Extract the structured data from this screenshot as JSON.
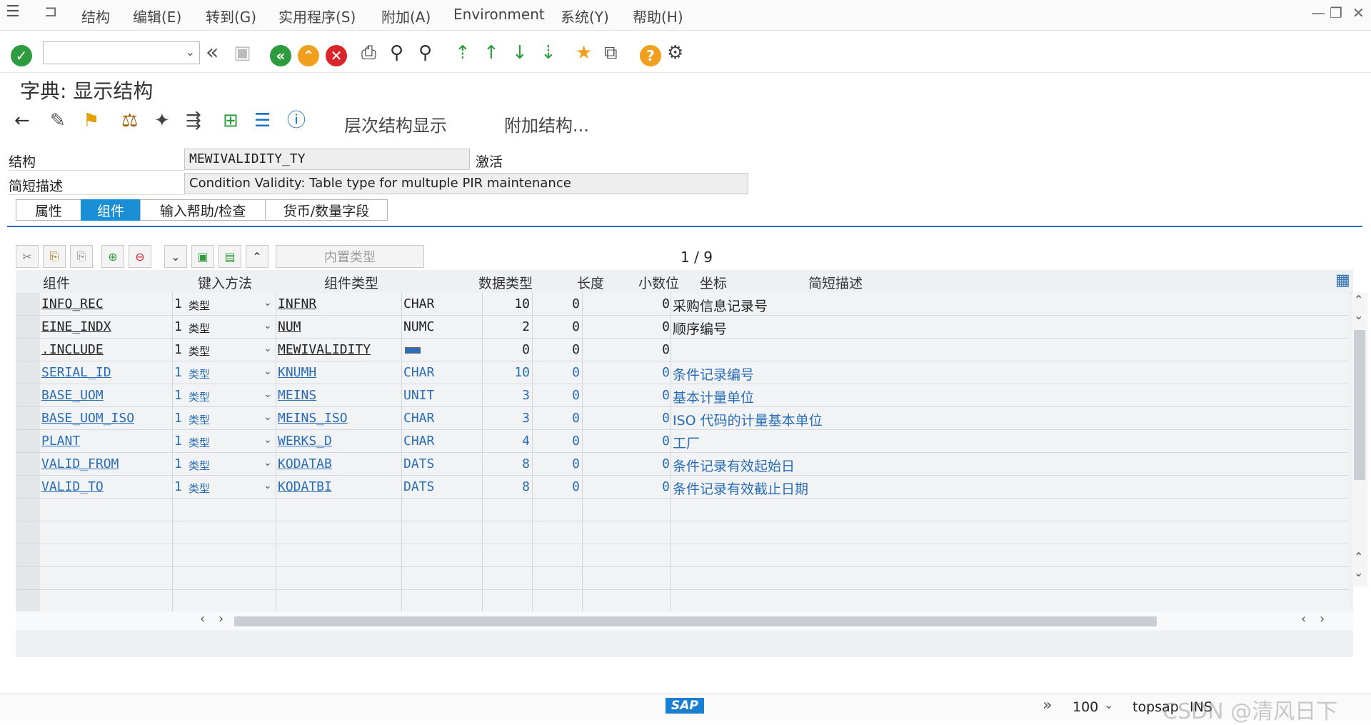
{
  "menu": {
    "items": [
      "结构",
      "编辑(E)",
      "转到(G)",
      "实用程序(S)",
      "附加(A)",
      "Environment",
      "系统(Y)",
      "帮助(H)"
    ]
  },
  "page": {
    "title": "字典: 显示结构"
  },
  "app_toolbar": {
    "hierarchy_label": "层次结构显示",
    "append_label": "附加结构..."
  },
  "fields": {
    "structure_label": "结构",
    "structure_value": "MEWIVALIDITY_TY",
    "status": "激活",
    "desc_label": "简短描述",
    "desc_value": "Condition Validity: Table type for multuple PIR maintenance"
  },
  "tabs": [
    "属性",
    "组件",
    "输入帮助/检查",
    "货币/数量字段"
  ],
  "grid_toolbar": {
    "builtin_type_label": "内置类型",
    "page_current": "1",
    "page_sep": "/",
    "page_total": "9"
  },
  "grid": {
    "headers": [
      "组件",
      "键入方法",
      "组件类型",
      "数据类型",
      "长度",
      "小数位",
      "坐标",
      "简短描述"
    ],
    "rows": [
      {
        "name": "INFO_REC",
        "method": "1",
        "method_label": "类型",
        "type": "INFNR",
        "dtype": "CHAR",
        "len": "10",
        "dec": "0",
        "coord": "0",
        "desc": "采购信息记录号",
        "style": "blk"
      },
      {
        "name": "EINE_INDX",
        "method": "1",
        "method_label": "类型",
        "type": "NUM",
        "dtype": "NUMC",
        "len": "2",
        "dec": "0",
        "coord": "0",
        "desc": "顺序编号",
        "style": "blk"
      },
      {
        "name": ".INCLUDE",
        "method": "1",
        "method_label": "类型",
        "type": "MEWIVALIDITY",
        "dtype": "",
        "len": "0",
        "dec": "0",
        "coord": "0",
        "desc": "",
        "style": "blk"
      },
      {
        "name": "SERIAL_ID",
        "method": "1",
        "method_label": "类型",
        "type": "KNUMH",
        "dtype": "CHAR",
        "len": "10",
        "dec": "0",
        "coord": "0",
        "desc": "条件记录编号",
        "style": "blue"
      },
      {
        "name": "BASE_UOM",
        "method": "1",
        "method_label": "类型",
        "type": "MEINS",
        "dtype": "UNIT",
        "len": "3",
        "dec": "0",
        "coord": "0",
        "desc": "基本计量单位",
        "style": "blue"
      },
      {
        "name": "BASE_UOM_ISO",
        "method": "1",
        "method_label": "类型",
        "type": "MEINS_ISO",
        "dtype": "CHAR",
        "len": "3",
        "dec": "0",
        "coord": "0",
        "desc": "ISO 代码的计量基本单位",
        "style": "blue"
      },
      {
        "name": "PLANT",
        "method": "1",
        "method_label": "类型",
        "type": "WERKS_D",
        "dtype": "CHAR",
        "len": "4",
        "dec": "0",
        "coord": "0",
        "desc": "工厂",
        "style": "blue"
      },
      {
        "name": "VALID_FROM",
        "method": "1",
        "method_label": "类型",
        "type": "KODATAB",
        "dtype": "DATS",
        "len": "8",
        "dec": "0",
        "coord": "0",
        "desc": "条件记录有效起始日",
        "style": "blue"
      },
      {
        "name": "VALID_TO",
        "method": "1",
        "method_label": "类型",
        "type": "KODATBI",
        "dtype": "DATS",
        "len": "8",
        "dec": "0",
        "coord": "0",
        "desc": "条件记录有效截止日期",
        "style": "blue"
      }
    ],
    "empty_rows": 5
  },
  "status": {
    "zoom": "100",
    "system": "topsap",
    "mode": "INS",
    "logo": "SAP",
    "watermark": "CSDN @清风日下"
  },
  "colors": {
    "accent": "#1a8fd6",
    "link_blue": "#2a6db5",
    "ok_green": "#2e9b3e",
    "cancel_red": "#d9262b",
    "help_orange": "#f0a01e"
  }
}
